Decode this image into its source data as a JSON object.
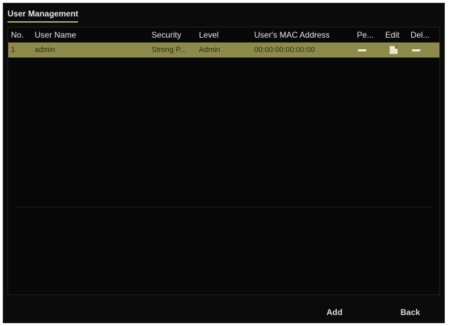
{
  "title": "User Management",
  "table": {
    "headers": {
      "no": "No.",
      "user_name": "User Name",
      "security": "Security",
      "level": "Level",
      "mac": "User's MAC Address",
      "permission": "Pe...",
      "edit": "Edit",
      "delete": "Del..."
    },
    "rows": [
      {
        "no": "1",
        "user_name": "admin",
        "security": "Strong P...",
        "level": "Admin",
        "mac": "00:00:00:00:00:00"
      }
    ]
  },
  "buttons": {
    "add": "Add",
    "back": "Back"
  },
  "colors": {
    "selected_row": "#8e8a4a",
    "tab_underline": "#b8b05a",
    "background": "#0b0b0b"
  },
  "icons": {
    "permission": "dash-icon",
    "edit": "edit-icon",
    "delete": "dash-icon"
  }
}
